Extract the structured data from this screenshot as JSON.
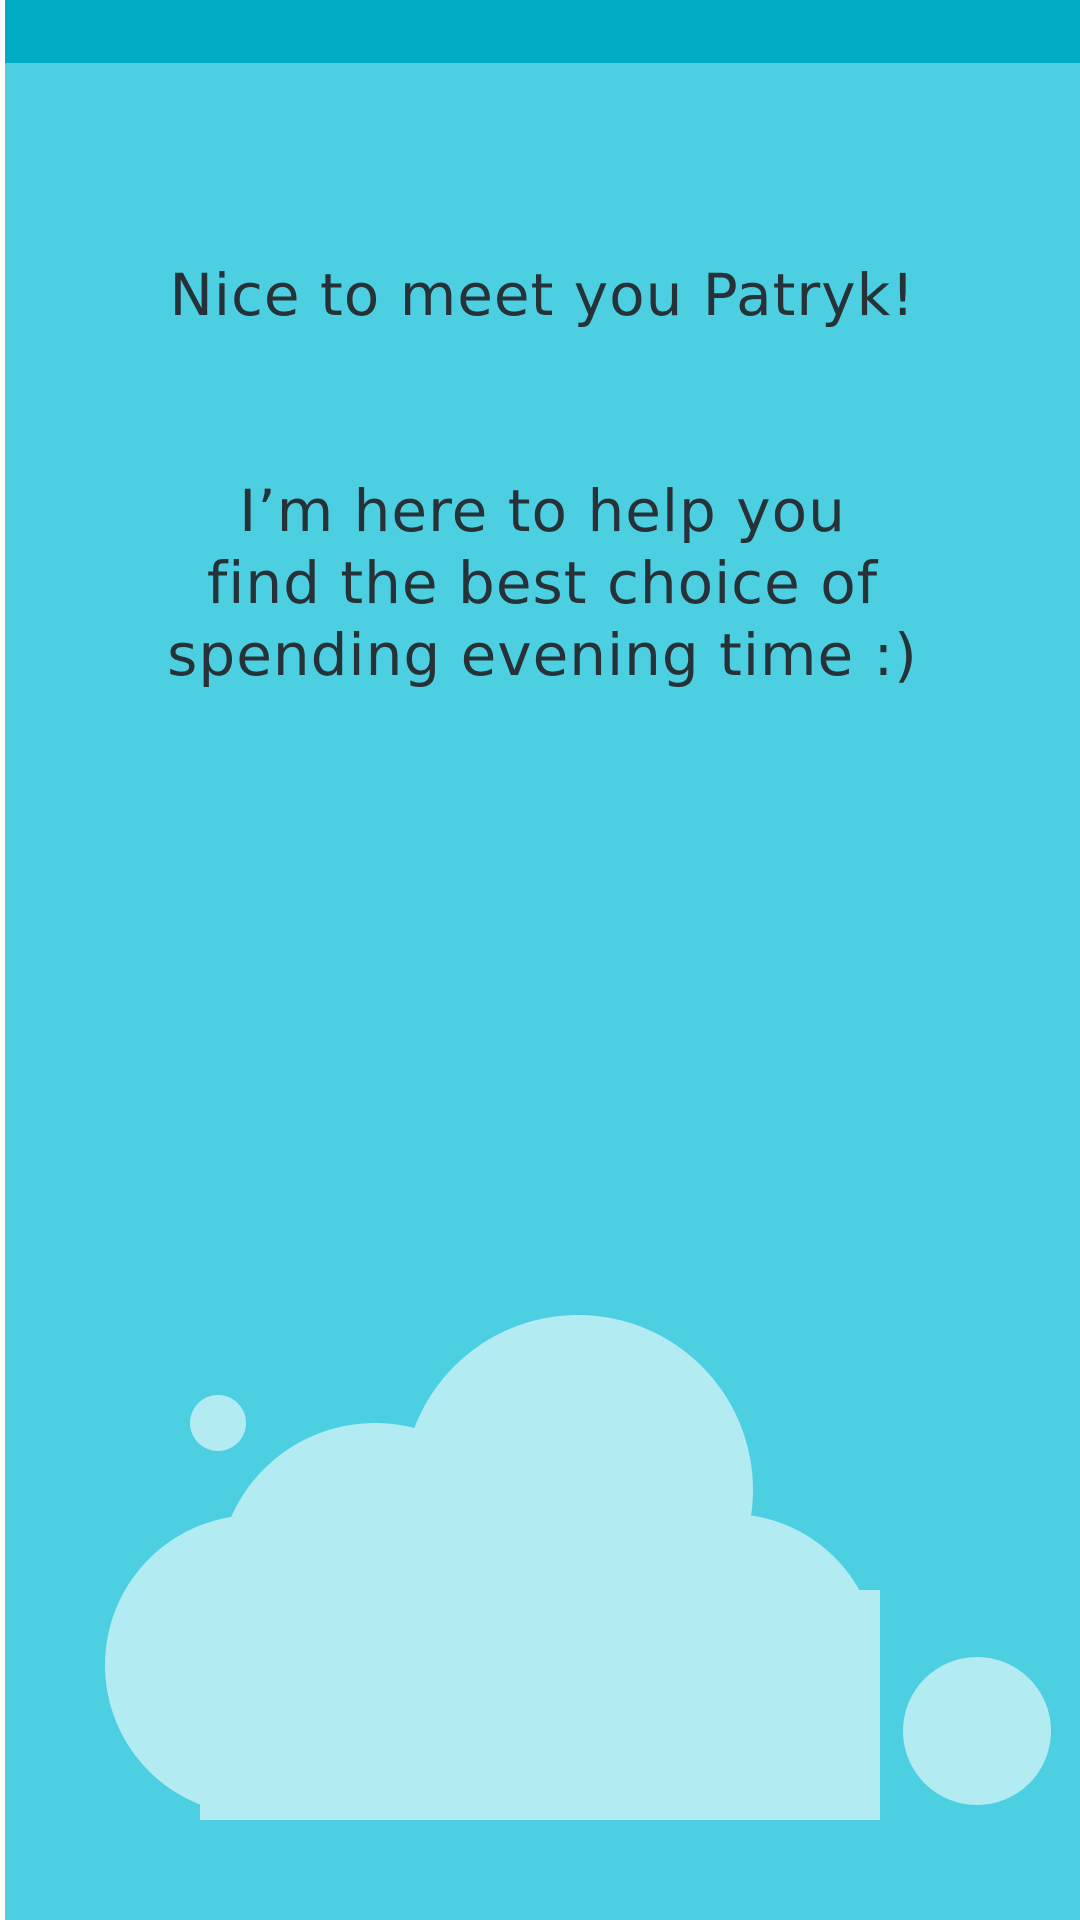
{
  "screen": {
    "greeting": "Nice to meet you Patryk!",
    "message_lines": [
      "I’m here to help you",
      "find the best choice of",
      "spending evening time :)"
    ]
  },
  "colors": {
    "background": "#4dcfe2",
    "status_bar": "#00acc4",
    "text": "#263238",
    "cloud": "#b3ebf3"
  },
  "illustration": {
    "icon": "cloud-icon"
  }
}
